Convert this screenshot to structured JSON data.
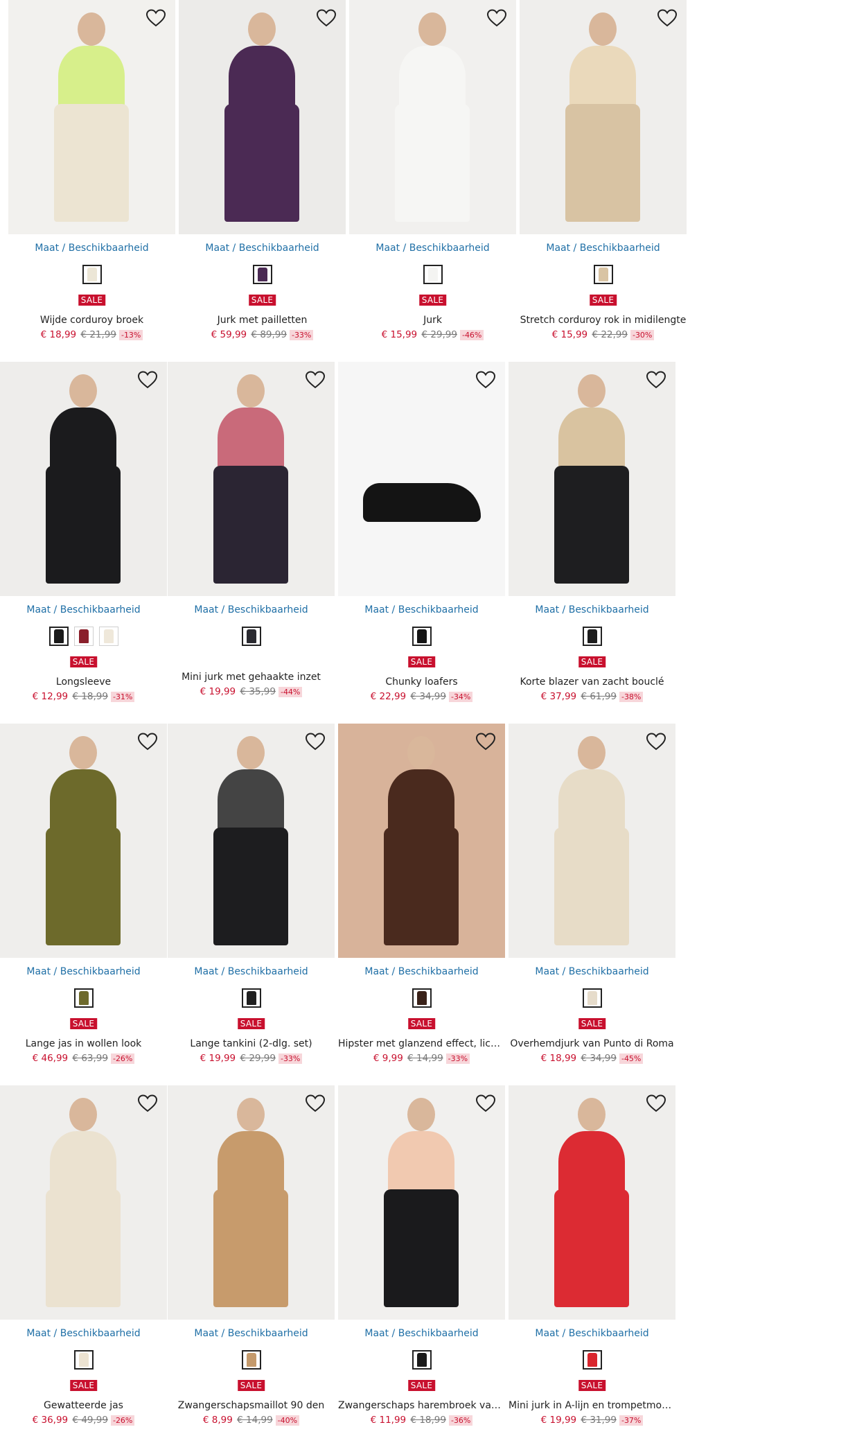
{
  "size_link_label": "Maat / Beschikbaarheid",
  "sale_label": "SALE",
  "colors": {
    "sale": "#c8102e",
    "link": "#1f6fa6",
    "discount_bg": "#f7d6da"
  },
  "products": [
    {
      "name": "Wijde corduroy broek",
      "price": "€ 18,99",
      "old_price": "€ 21,99",
      "discount": "-13%",
      "sale": true,
      "swatches": [
        "#ece6d6"
      ],
      "photo": {
        "bg": "#f2f1ee",
        "garment": "#ece4d2",
        "top": "#d7ef8b"
      }
    },
    {
      "name": "Jurk met pailletten",
      "price": "€ 59,99",
      "old_price": "€ 89,99",
      "discount": "-33%",
      "sale": true,
      "swatches": [
        "#4b2a54"
      ],
      "photo": {
        "bg": "#ecebe9",
        "garment": "#4b2a54",
        "top": "#4b2a54"
      }
    },
    {
      "name": "Jurk",
      "price": "€ 15,99",
      "old_price": "€ 29,99",
      "discount": "-46%",
      "sale": true,
      "swatches": [
        "#f4f4f2"
      ],
      "photo": {
        "bg": "#f1f0ee",
        "garment": "#f6f6f4",
        "top": "#f6f6f4"
      }
    },
    {
      "name": "Stretch corduroy rok in midilengte",
      "price": "€ 15,99",
      "old_price": "€ 22,99",
      "discount": "-30%",
      "sale": true,
      "swatches": [
        "#d9c4a4"
      ],
      "photo": {
        "bg": "#efeeec",
        "garment": "#d8c3a3",
        "top": "#ead9bb"
      }
    },
    {
      "name": "Longsleeve",
      "price": "€ 12,99",
      "old_price": "€ 18,99",
      "discount": "-31%",
      "sale": true,
      "swatches": [
        "#1a1a1a",
        "#8a1f2b",
        "#efe8da"
      ],
      "photo": {
        "bg": "#eeedeb",
        "garment": "#1b1b1d",
        "top": "#1b1b1d"
      }
    },
    {
      "name": "Mini jurk met gehaakte inzet",
      "price": "€ 19,99",
      "old_price": "€ 35,99",
      "discount": "-44%",
      "sale": false,
      "swatches": [
        "#2a2a30"
      ],
      "photo": {
        "bg": "#efeeec",
        "garment": "#2b2533",
        "top": "#c96a7a"
      }
    },
    {
      "name": "Chunky loafers",
      "price": "€ 22,99",
      "old_price": "€ 34,99",
      "discount": "-34%",
      "sale": true,
      "swatches": [
        "#151515"
      ],
      "photo": {
        "bg": "#f6f6f6",
        "garment": "#141414",
        "top": "#141414"
      }
    },
    {
      "name": "Korte blazer van zacht bouclé",
      "price": "€ 37,99",
      "old_price": "€ 61,99",
      "discount": "-38%",
      "sale": true,
      "swatches": [
        "#1c1c1c"
      ],
      "photo": {
        "bg": "#efeeec",
        "garment": "#1e1e20",
        "top": "#d9c3a0"
      }
    },
    {
      "name": "Lange jas in wollen look",
      "price": "€ 46,99",
      "old_price": "€ 63,99",
      "discount": "-26%",
      "sale": true,
      "swatches": [
        "#6e6a2c"
      ],
      "photo": {
        "bg": "#efeeec",
        "garment": "#6d6a2b",
        "top": "#6d6a2b"
      }
    },
    {
      "name": "Lange tankini (2-dlg. set)",
      "price": "€ 19,99",
      "old_price": "€ 29,99",
      "discount": "-33%",
      "sale": true,
      "swatches": [
        "#202020"
      ],
      "photo": {
        "bg": "#efeeec",
        "garment": "#1d1d1f",
        "top": "#444"
      }
    },
    {
      "name": "Hipster met glanzend effect, licht corrigerend",
      "price": "€ 9,99",
      "old_price": "€ 14,99",
      "discount": "-33%",
      "sale": true,
      "swatches": [
        "#3a2219"
      ],
      "photo": {
        "bg": "#d8b39a",
        "garment": "#4a2a1e",
        "top": "#4a2a1e"
      }
    },
    {
      "name": "Overhemdjurk van Punto di Roma",
      "price": "€ 18,99",
      "old_price": "€ 34,99",
      "discount": "-45%",
      "sale": true,
      "swatches": [
        "#e6dccb"
      ],
      "photo": {
        "bg": "#efeeec",
        "garment": "#e7dcc7",
        "top": "#e7dcc7"
      }
    },
    {
      "name": "Gewatteerde jas",
      "price": "€ 36,99",
      "old_price": "€ 49,99",
      "discount": "-26%",
      "sale": true,
      "swatches": [
        "#ece3d2"
      ],
      "photo": {
        "bg": "#efeeec",
        "garment": "#ebe2d0",
        "top": "#ebe2d0"
      }
    },
    {
      "name": "Zwangerschapsmaillot 90 den",
      "price": "€ 8,99",
      "old_price": "€ 14,99",
      "discount": "-40%",
      "sale": true,
      "swatches": [
        "#c49a6c"
      ],
      "photo": {
        "bg": "#efeeec",
        "garment": "#c79b6c",
        "top": "#c79b6c"
      }
    },
    {
      "name": "Zwangerschaps harembroek van jersey",
      "price": "€ 11,99",
      "old_price": "€ 18,99",
      "discount": "-36%",
      "sale": true,
      "swatches": [
        "#1a1a1a"
      ],
      "photo": {
        "bg": "#f1f0ee",
        "garment": "#1a1a1c",
        "top": "#f1c9b0"
      }
    },
    {
      "name": "Mini jurk in A-lijn en trompetmouwen",
      "price": "€ 19,99",
      "old_price": "€ 31,99",
      "discount": "-37%",
      "sale": true,
      "swatches": [
        "#d9262e"
      ],
      "photo": {
        "bg": "#efeeec",
        "garment": "#dc2b33",
        "top": "#dc2b33"
      }
    }
  ]
}
